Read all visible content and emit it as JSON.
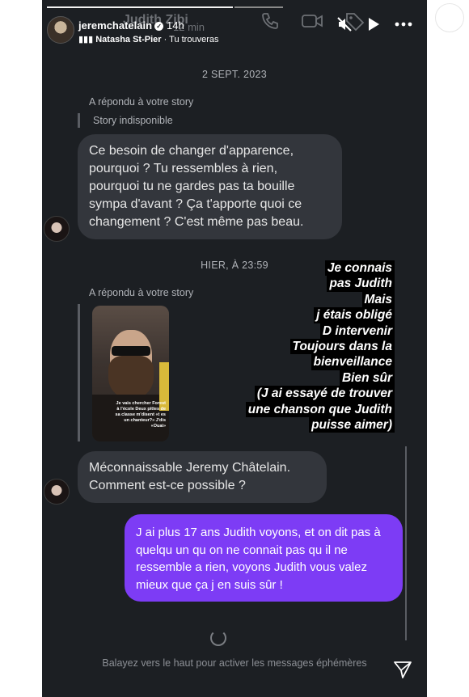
{
  "header": {
    "username": "jeremchatelain",
    "time": "14h",
    "ghost_title": "Judith Zibi",
    "ghost_time": "12 min",
    "music_artist": "Natasha St-Pier",
    "music_song": "Tu trouveras"
  },
  "dates": {
    "first": "2 SEPT. 2023",
    "second": "HIER, À 23:59"
  },
  "messages": {
    "reply_note_1": "A répondu à votre story",
    "story_unavailable": "Story indisponible",
    "bubble_1": "Ce besoin de changer d'apparence, pourquoi ? Tu ressembles à rien, pourquoi tu ne gardes pas ta bouille sympa d'avant ? Ça t'apporte quoi ce changement ? C'est même pas beau.",
    "reply_note_2": "A répondu à votre story",
    "bubble_2": "Méconnaissable Jeremy Châtelain. Comment est-ce possible ?",
    "outgoing": "J ai plus 17 ans Judith voyons, et on dit pas à quelqu un qu on ne connait pas qu il ne ressemble a rien, voyons Judith vous valez mieux que ça j en suis sûr !"
  },
  "thumbnail_caption": "Je vais chercher Forest à l'école Deux pittes de sa classe m'disent «t es un chanteur?» J'dis «Ouai»",
  "overlay_lines": [
    "Je connais",
    "pas Judith",
    "Mais",
    "j étais obligé",
    "D intervenir",
    "Toujours dans la",
    "bienveillance",
    "Bien sûr",
    "(J ai essayé de trouver",
    "une chanson que Judith",
    "puisse aimer)"
  ],
  "footer": {
    "ephemeral_hint": "Balayez vers le haut pour activer les messages éphémères"
  },
  "icons": [
    "back-icon",
    "phone-icon",
    "video-icon",
    "tag-icon",
    "mute-icon",
    "play-icon",
    "more-icon",
    "music-icon",
    "send-icon",
    "verified-icon"
  ],
  "colors": {
    "background": "#1c1f23",
    "incoming_bubble": "#33363c",
    "outgoing_bubble": "#7d3cf5"
  }
}
